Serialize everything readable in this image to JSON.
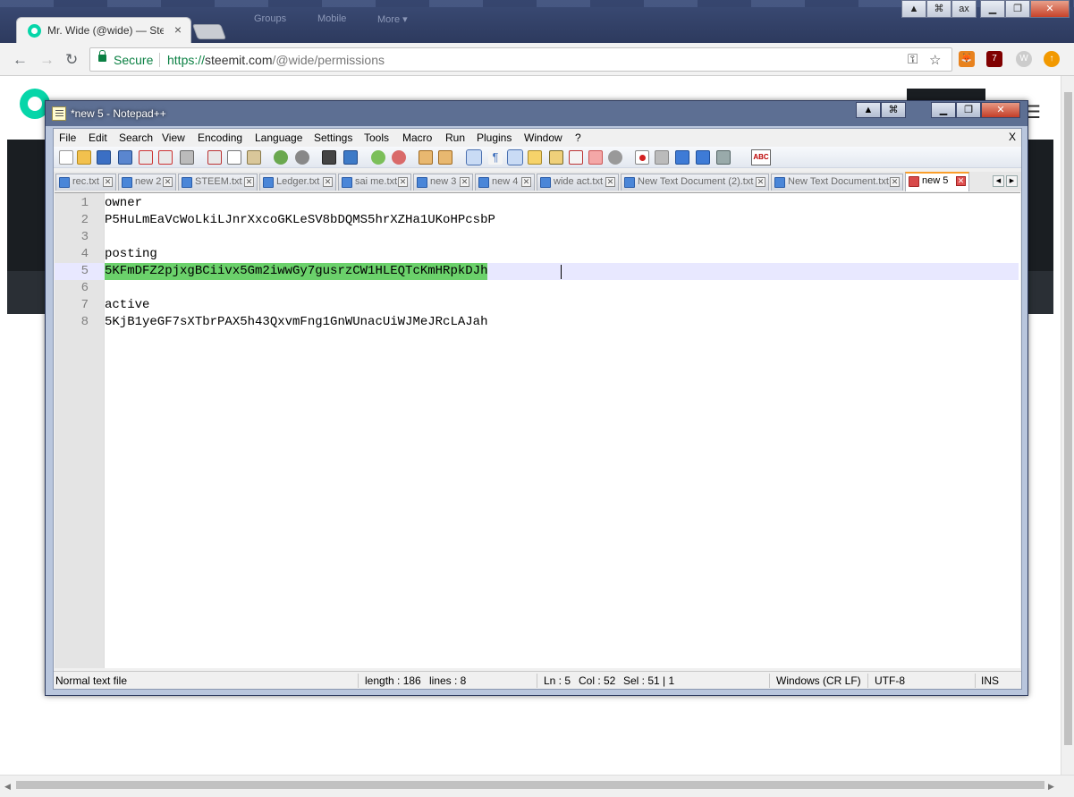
{
  "browser": {
    "tab_title": "Mr. Wide (@wide) — Ste",
    "tab_close": "×",
    "background_nav": [
      "Groups",
      "Mobile",
      "More ▾"
    ],
    "window_user": "ax",
    "window_buttons": {
      "minimize": "▁",
      "maximize": "❐",
      "close": "✕"
    },
    "nav": {
      "back": "←",
      "forward": "→",
      "reload": "↻"
    },
    "secure_label": "Secure",
    "url_scheme": "https://",
    "url_host": "steemit.com",
    "url_path": "/@wide/permissions",
    "extension_badge": "7",
    "colors": {
      "accent": "#06d6a9",
      "secure": "#0b8043"
    }
  },
  "notepad": {
    "title": "*new 5 - Notepad++",
    "menu": [
      "File",
      "Edit",
      "Search",
      "View",
      "Encoding",
      "Language",
      "Settings",
      "Tools",
      "Macro",
      "Run",
      "Plugins",
      "Window",
      "?"
    ],
    "menu_close": "X",
    "tabs": [
      {
        "label": "rec.txt",
        "active": false
      },
      {
        "label": "new 2",
        "active": false
      },
      {
        "label": "STEEM.txt",
        "active": false
      },
      {
        "label": "Ledger.txt",
        "active": false
      },
      {
        "label": "sai me.txt",
        "active": false
      },
      {
        "label": "new 3",
        "active": false
      },
      {
        "label": "new 4",
        "active": false
      },
      {
        "label": "wide act.txt",
        "active": false
      },
      {
        "label": "New Text Document (2).txt",
        "active": false
      },
      {
        "label": "New Text Document.txt",
        "active": false
      },
      {
        "label": "new 5",
        "active": true
      }
    ],
    "tab_close": "✕",
    "lines": [
      {
        "num": "1",
        "text": "owner"
      },
      {
        "num": "2",
        "text": "P5HuLmEaVcWoLkiLJnrXxcoGKLeSV8bDQMS5hrXZHa1UKoHPcsbP"
      },
      {
        "num": "3",
        "text": ""
      },
      {
        "num": "4",
        "text": "posting"
      },
      {
        "num": "5",
        "text": "5KFmDFZ2pjxgBCiivx5Gm2iwwGy7gusrzCW1HLEQTcKmHRpkDJh"
      },
      {
        "num": "6",
        "text": ""
      },
      {
        "num": "7",
        "text": "active"
      },
      {
        "num": "8",
        "text": "5KjB1yeGF7sXTbrPAX5h43QxvmFng1GnWUnacUiWJMeJRcLAJah"
      }
    ],
    "current_line": 5,
    "status": {
      "file_type": "Normal text file",
      "length": "length : 186",
      "lines": "lines : 8",
      "ln": "Ln : 5",
      "col": "Col : 52",
      "sel": "Sel : 51 | 1",
      "eol": "Windows (CR LF)",
      "encoding": "UTF-8",
      "mode": "INS"
    },
    "toolbar_spellcheck": "ABC",
    "colors": {
      "selection": "#6bd16b",
      "current_line": "#e8e8ff",
      "active_tab_accent": "#fa9e2b"
    }
  }
}
